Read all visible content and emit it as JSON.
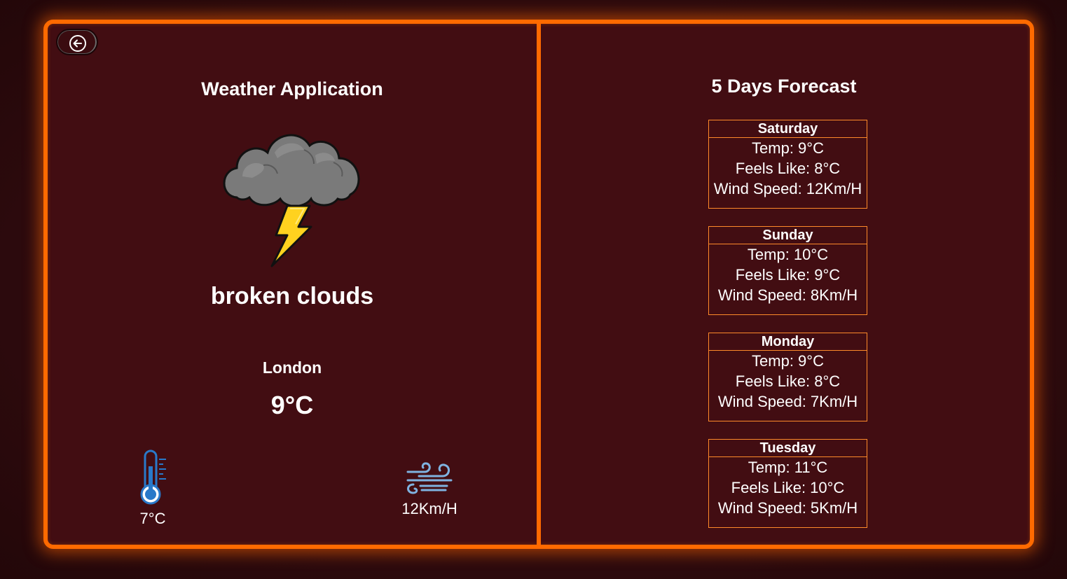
{
  "app": {
    "title": "Weather Application",
    "accent_color": "#ff6a00",
    "background_color": "#420d12"
  },
  "navigation": {
    "back_icon": "arrow-left-circle-icon"
  },
  "current": {
    "icon": "thunderstorm-cloud-icon",
    "description": "broken clouds",
    "city": "London",
    "temperature": "9°C",
    "feels_like": {
      "icon": "thermometer-icon",
      "value": "7°C"
    },
    "wind": {
      "icon": "wind-icon",
      "value": "12Km/H"
    }
  },
  "forecast": {
    "title": "5 Days Forecast",
    "days": [
      {
        "day": "Saturday",
        "temp": "Temp: 9°C",
        "feels_like": "Feels Like: 8°C",
        "wind": "Wind Speed: 12Km/H"
      },
      {
        "day": "Sunday",
        "temp": "Temp: 10°C",
        "feels_like": "Feels Like: 9°C",
        "wind": "Wind Speed: 8Km/H"
      },
      {
        "day": "Monday",
        "temp": "Temp: 9°C",
        "feels_like": "Feels Like: 8°C",
        "wind": "Wind Speed: 7Km/H"
      },
      {
        "day": "Tuesday",
        "temp": "Temp: 11°C",
        "feels_like": "Feels Like: 10°C",
        "wind": "Wind Speed: 5Km/H"
      }
    ]
  }
}
